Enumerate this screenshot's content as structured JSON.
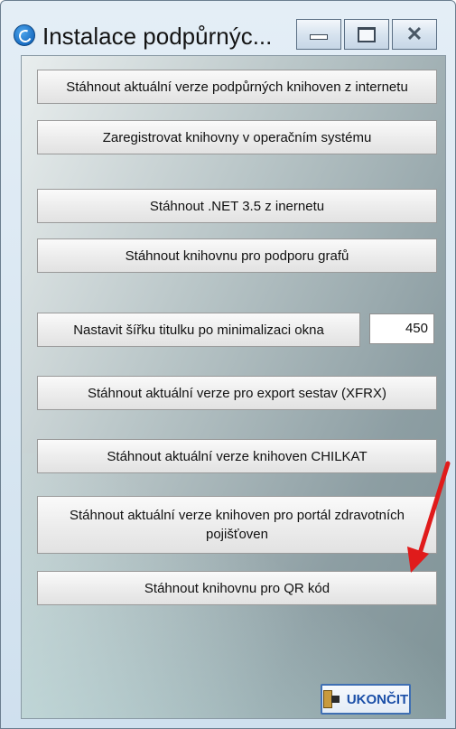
{
  "window": {
    "title": "Instalace podpůrnýc...",
    "close_glyph": "✕"
  },
  "buttons": {
    "download_libraries": "Stáhnout aktuální verze podpůrných knihoven z internetu",
    "register_libraries": "Zaregistrovat knihovny v operačním systému",
    "download_net": "Stáhnout .NET 3.5 z inernetu",
    "download_charts": "Stáhnout knihovnu pro podporu grafů",
    "set_title_width": "Nastavit šířku titulku po minimalizaci okna",
    "download_export": "Stáhnout aktuální verze pro export sestav (XFRX)",
    "download_chilkat": "Stáhnout aktuální verze knihoven CHILKAT",
    "download_portal": "Stáhnout aktuální verze knihoven pro portál zdravotních pojišťoven",
    "download_qr": "Stáhnout knihovnu pro QR kód",
    "exit": "UKONČIT"
  },
  "fields": {
    "title_width_value": "450"
  },
  "annotation": {
    "arrow_color": "#e01b1b"
  }
}
